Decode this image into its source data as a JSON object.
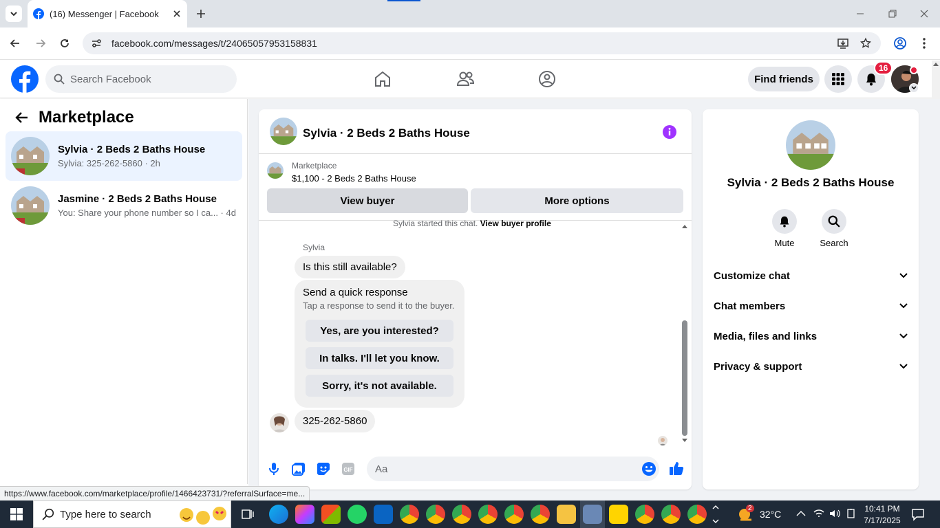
{
  "browser": {
    "tab_title": "(16) Messenger | Facebook",
    "url": "facebook.com/messages/t/24065057953158831",
    "status_url": "https://www.facebook.com/marketplace/profile/1466423731/?referralSurface=me..."
  },
  "fb_header": {
    "search_placeholder": "Search Facebook",
    "find_friends": "Find friends",
    "notification_count": "16"
  },
  "sidebar": {
    "title": "Marketplace",
    "conversations": [
      {
        "name": "Sylvia · 2 Beds 2 Baths House",
        "preview": "Sylvia: 325-262-5860 · 2h"
      },
      {
        "name": "Jasmine · 2 Beds 2 Baths House",
        "preview": "You: Share your phone number so I ca... · 4d"
      }
    ]
  },
  "chat": {
    "title": "Sylvia · 2 Beds 2 Baths House",
    "listing_source": "Marketplace",
    "listing_title": "$1,100 - 2 Beds 2 Baths House",
    "view_buyer": "View buyer",
    "more_options": "More options",
    "started_text": "Sylvia started this chat.",
    "view_buyer_profile": "View buyer profile",
    "sender_name": "Sylvia",
    "message1": "Is this still available?",
    "quick_title": "Send a quick response",
    "quick_sub": "Tap a response to send it to the buyer.",
    "quick_replies": [
      "Yes, are you interested?",
      "In talks. I'll let you know.",
      "Sorry, it's not available."
    ],
    "message2": "325-262-5860",
    "input_placeholder": "Aa"
  },
  "info_panel": {
    "name": "Sylvia · 2 Beds 2 Baths House",
    "mute": "Mute",
    "search": "Search",
    "sections": [
      "Customize chat",
      "Chat members",
      "Media, files and links",
      "Privacy & support"
    ]
  },
  "taskbar": {
    "search_placeholder": "Type here to search",
    "weather": "32°C",
    "weather_badge": "2",
    "time": "10:41 PM",
    "date": "7/17/2025"
  },
  "colors": {
    "facebook_blue": "#0866ff",
    "messenger_accent": "#a033ff",
    "badge_red": "#e41e3f"
  }
}
